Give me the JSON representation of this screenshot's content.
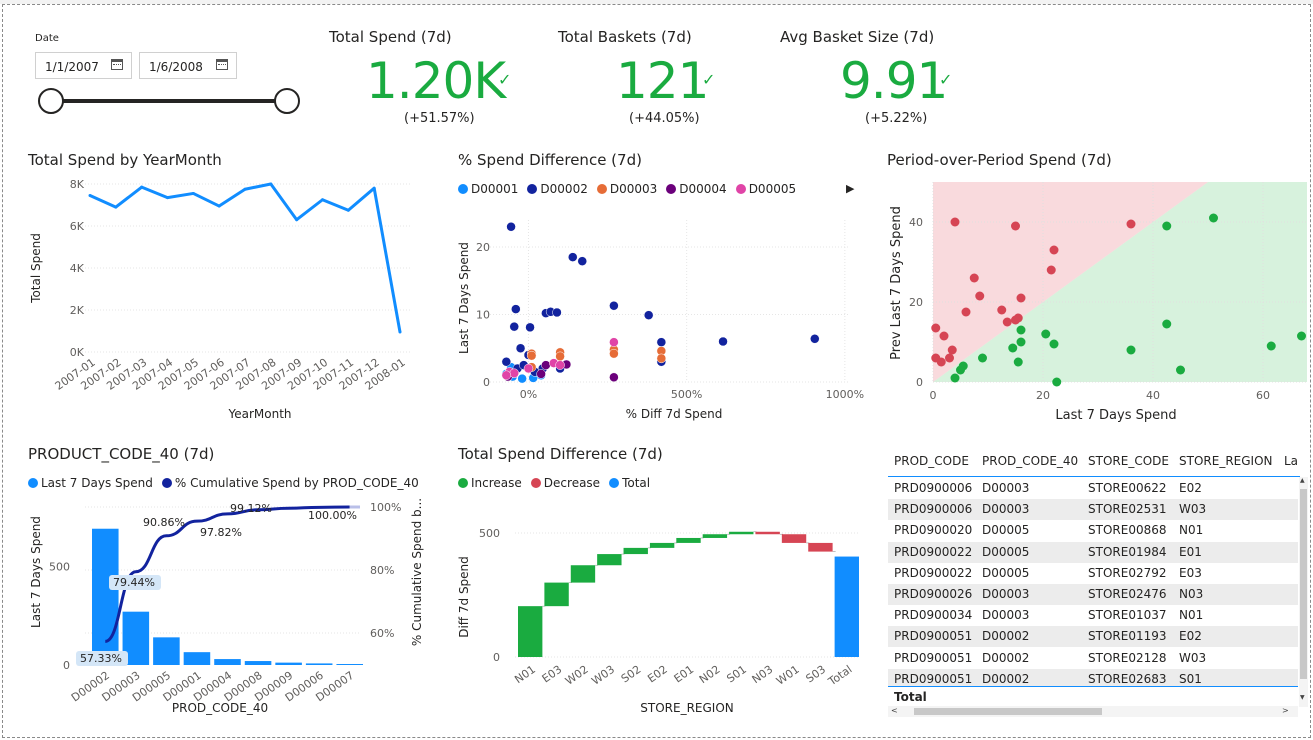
{
  "slicer": {
    "label": "Date",
    "start": "1/1/2007",
    "end": "1/6/2008"
  },
  "kpis": [
    {
      "title": "Total Spend (7d)",
      "value": "1.20K",
      "delta": "(+51.57%)"
    },
    {
      "title": "Total Baskets (7d)",
      "value": "121",
      "delta": "(+44.05%)"
    },
    {
      "title": "Avg Basket Size (7d)",
      "value": "9.91",
      "delta": "(+5.22%)"
    }
  ],
  "colors": {
    "accent": "#118dff",
    "kpi_green": "#1aab40",
    "dark_navy": "#12239e",
    "increase": "#1aab40",
    "decrease": "#d64554",
    "total": "#118dff"
  },
  "chart_data": [
    {
      "id": "line",
      "type": "line",
      "title": "Total Spend by YearMonth",
      "xlabel": "YearMonth",
      "ylabel": "Total Spend",
      "categories": [
        "2007-01",
        "2007-02",
        "2007-03",
        "2007-04",
        "2007-05",
        "2007-06",
        "2007-07",
        "2007-08",
        "2007-09",
        "2007-10",
        "2007-11",
        "2007-12",
        "2008-01"
      ],
      "values": [
        7450,
        6900,
        7850,
        7350,
        7550,
        6950,
        7750,
        8000,
        6300,
        7250,
        6750,
        7800,
        950
      ],
      "yticks": [
        "0K",
        "2K",
        "4K",
        "6K",
        "8K"
      ],
      "ylim": [
        0,
        8000
      ],
      "color": "#118dff"
    },
    {
      "id": "scatter",
      "type": "scatter",
      "title": "% Spend Difference (7d)",
      "xlabel": "% Diff 7d Spend",
      "ylabel": "Last 7 Days Spend",
      "xticks": [
        "0%",
        "500%",
        "1000%"
      ],
      "yticks": [
        "0",
        "10",
        "20"
      ],
      "xlim": [
        -90,
        1010
      ],
      "ylim": [
        0,
        24
      ],
      "legend": [
        {
          "name": "D00001",
          "color": "#118dff"
        },
        {
          "name": "D00002",
          "color": "#12239e"
        },
        {
          "name": "D00003",
          "color": "#e66c37"
        },
        {
          "name": "D00004",
          "color": "#6b007b"
        },
        {
          "name": "D00005",
          "color": "#e044a7"
        }
      ],
      "points": [
        [
          -70,
          1.2,
          0
        ],
        [
          -50,
          0.8,
          0
        ],
        [
          -20,
          0.5,
          0
        ],
        [
          15,
          0.6,
          0
        ],
        [
          40,
          1.0,
          0
        ],
        [
          -55,
          2.2,
          0
        ],
        [
          -70,
          3.0,
          1
        ],
        [
          -55,
          23.0,
          1
        ],
        [
          -45,
          8.2,
          1
        ],
        [
          -40,
          10.8,
          1
        ],
        [
          -35,
          2.0,
          1
        ],
        [
          -25,
          5.0,
          1
        ],
        [
          -15,
          2.5,
          1
        ],
        [
          0,
          4.0,
          1
        ],
        [
          5,
          8.1,
          1
        ],
        [
          20,
          1.5,
          1
        ],
        [
          45,
          2.0,
          1
        ],
        [
          55,
          10.2,
          1
        ],
        [
          70,
          10.4,
          1
        ],
        [
          90,
          10.3,
          1
        ],
        [
          140,
          18.5,
          1
        ],
        [
          170,
          17.9,
          1
        ],
        [
          270,
          11.3,
          1
        ],
        [
          380,
          9.9,
          1
        ],
        [
          420,
          3.0,
          1
        ],
        [
          420,
          5.9,
          1
        ],
        [
          615,
          6.0,
          1
        ],
        [
          905,
          6.4,
          1
        ],
        [
          100,
          2.0,
          1
        ],
        [
          10,
          4.2,
          2
        ],
        [
          10,
          3.9,
          2
        ],
        [
          100,
          4.4,
          2
        ],
        [
          100,
          3.8,
          2
        ],
        [
          270,
          4.8,
          2
        ],
        [
          270,
          4.2,
          2
        ],
        [
          420,
          4.6,
          2
        ],
        [
          420,
          3.5,
          2
        ],
        [
          10,
          2.2,
          2
        ],
        [
          40,
          1.2,
          3
        ],
        [
          55,
          2.5,
          3
        ],
        [
          270,
          0.7,
          3
        ],
        [
          -65,
          0.8,
          3
        ],
        [
          120,
          2.6,
          3
        ],
        [
          -60,
          1.5,
          4
        ],
        [
          -45,
          1.3,
          4
        ],
        [
          -70,
          1.0,
          4
        ],
        [
          80,
          2.8,
          4
        ],
        [
          100,
          2.5,
          4
        ],
        [
          270,
          5.9,
          4
        ],
        [
          0,
          2.0,
          4
        ]
      ]
    },
    {
      "id": "pop",
      "type": "scatter",
      "title": "Period-over-Period Spend (7d)",
      "xlabel": "Last 7 Days Spend",
      "ylabel": "Prev Last 7 Days Spend",
      "xticks": [
        "0",
        "20",
        "40",
        "60"
      ],
      "yticks": [
        "0",
        "20",
        "40"
      ],
      "xlim": [
        0,
        68
      ],
      "ylim": [
        0,
        50
      ],
      "increase_color": "#1aab40",
      "decrease_color": "#d64554",
      "decrease": [
        [
          0.5,
          13.5
        ],
        [
          0.5,
          6
        ],
        [
          1.5,
          5
        ],
        [
          2,
          11.5
        ],
        [
          3,
          6
        ],
        [
          3.5,
          8
        ],
        [
          4,
          40
        ],
        [
          6,
          17.5
        ],
        [
          7.5,
          26
        ],
        [
          8.5,
          21.5
        ],
        [
          12.5,
          18
        ],
        [
          13.5,
          15
        ],
        [
          15,
          15.5
        ],
        [
          15.5,
          16
        ],
        [
          15,
          39
        ],
        [
          16,
          21
        ],
        [
          21.5,
          28
        ],
        [
          22,
          33
        ],
        [
          36,
          39.5
        ]
      ],
      "increase": [
        [
          4,
          1
        ],
        [
          5,
          3
        ],
        [
          5.5,
          4
        ],
        [
          9,
          6
        ],
        [
          14.5,
          8.5
        ],
        [
          15.5,
          5
        ],
        [
          16,
          10
        ],
        [
          16,
          13
        ],
        [
          20.5,
          12
        ],
        [
          22,
          9.5
        ],
        [
          22.5,
          0
        ],
        [
          36,
          8
        ],
        [
          42.5,
          39
        ],
        [
          42.5,
          14.5
        ],
        [
          45,
          3
        ],
        [
          51,
          41
        ],
        [
          61.5,
          9
        ],
        [
          67,
          11.5
        ]
      ]
    },
    {
      "id": "pareto",
      "type": "bar",
      "title": "PRODUCT_CODE_40 (7d)",
      "xlabel": "PROD_CODE_40",
      "ylabel": "Last 7 Days Spend",
      "y2label": "% Cumulative Spend b...",
      "categories": [
        "D00002",
        "D00003",
        "D00005",
        "D00001",
        "D00004",
        "D00008",
        "D00009",
        "D00006",
        "D00007"
      ],
      "values": [
        690,
        270,
        140,
        65,
        30,
        20,
        12,
        8,
        5
      ],
      "cumulative": [
        57.33,
        79.44,
        90.86,
        95.5,
        97.82,
        99.12,
        99.6,
        99.9,
        100.0
      ],
      "data_labels": [
        "57.33%",
        "79.44%",
        "90.86%",
        "",
        "97.82%",
        "99.12%",
        "",
        "",
        "100.00%"
      ],
      "yticks": [
        "0",
        "500"
      ],
      "y2ticks": [
        "60%",
        "80%",
        "100%"
      ],
      "ylim": [
        0,
        800
      ],
      "y2lim": [
        50,
        100
      ],
      "legend": [
        {
          "name": "Last 7 Days Spend",
          "color": "#118dff"
        },
        {
          "name": "% Cumulative Spend by PROD_CODE_40",
          "color": "#12239e"
        }
      ]
    },
    {
      "id": "waterfall",
      "type": "bar",
      "title": "Total Spend Difference (7d)",
      "xlabel": "STORE_REGION",
      "ylabel": "Diff 7d Spend",
      "categories": [
        "N01",
        "E03",
        "W02",
        "W03",
        "S02",
        "E02",
        "E01",
        "N02",
        "S01",
        "N03",
        "W01",
        "S03",
        "Total"
      ],
      "deltas": [
        205,
        95,
        70,
        45,
        25,
        20,
        20,
        15,
        10,
        -10,
        -35,
        -35,
        0
      ],
      "total": 405,
      "yticks": [
        "0",
        "500"
      ],
      "ylim": [
        0,
        560
      ],
      "legend": [
        {
          "name": "Increase",
          "color": "#1aab40"
        },
        {
          "name": "Decrease",
          "color": "#d64554"
        },
        {
          "name": "Total",
          "color": "#118dff"
        }
      ]
    }
  ],
  "table": {
    "headers": [
      "PROD_CODE",
      "PROD_CODE_40",
      "STORE_CODE",
      "STORE_REGION",
      "La"
    ],
    "rows": [
      [
        "PRD0900006",
        "D00003",
        "STORE00622",
        "E02"
      ],
      [
        "PRD0900006",
        "D00003",
        "STORE02531",
        "W03"
      ],
      [
        "PRD0900020",
        "D00005",
        "STORE00868",
        "N01"
      ],
      [
        "PRD0900022",
        "D00005",
        "STORE01984",
        "E01"
      ],
      [
        "PRD0900022",
        "D00005",
        "STORE02792",
        "E03"
      ],
      [
        "PRD0900026",
        "D00003",
        "STORE02476",
        "N03"
      ],
      [
        "PRD0900034",
        "D00003",
        "STORE01037",
        "N01"
      ],
      [
        "PRD0900051",
        "D00002",
        "STORE01193",
        "E02"
      ],
      [
        "PRD0900051",
        "D00002",
        "STORE02128",
        "W03"
      ],
      [
        "PRD0900051",
        "D00002",
        "STORE02683",
        "S01"
      ]
    ],
    "total_label": "Total"
  }
}
